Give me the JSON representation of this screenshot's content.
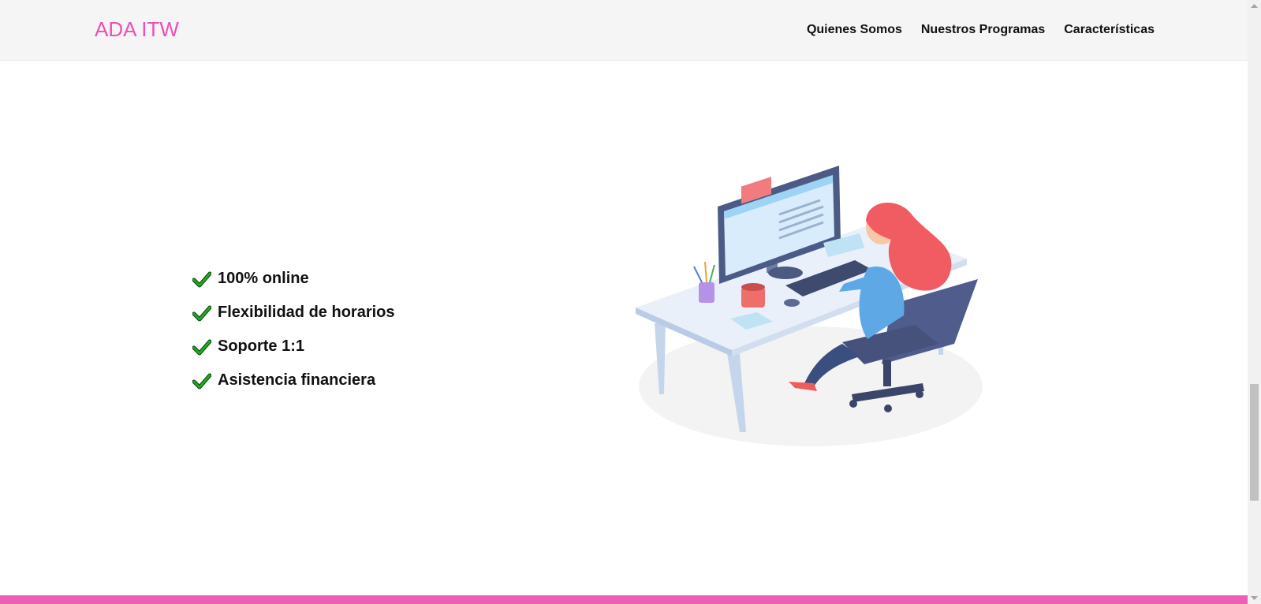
{
  "header": {
    "brand": "ADA ITW",
    "brand_color": "#ee4fb5",
    "nav": [
      {
        "label": "Quienes Somos"
      },
      {
        "label": "Nuestros Programas"
      },
      {
        "label": "Características"
      }
    ]
  },
  "features": {
    "icon": "check-icon",
    "icon_color": "#22a822",
    "items": [
      {
        "label": "100% online"
      },
      {
        "label": "Flexibilidad de horarios"
      },
      {
        "label": "Soporte 1:1"
      },
      {
        "label": "Asistencia financiera"
      }
    ]
  },
  "illustration": {
    "subject": "woman-at-computer-desk"
  },
  "footer": {
    "color": "#ec5fb4"
  }
}
